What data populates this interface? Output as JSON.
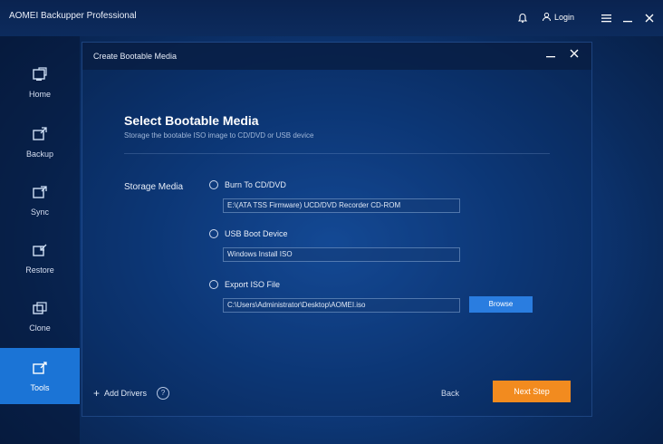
{
  "app": {
    "title": "AOMEI Backupper Professional",
    "login_label": "Login"
  },
  "sidebar": {
    "items": [
      {
        "label": "Home",
        "icon": "home-icon"
      },
      {
        "label": "Backup",
        "icon": "backup-icon"
      },
      {
        "label": "Sync",
        "icon": "sync-icon"
      },
      {
        "label": "Restore",
        "icon": "restore-icon"
      },
      {
        "label": "Clone",
        "icon": "clone-icon"
      },
      {
        "label": "Tools",
        "icon": "tools-icon",
        "active": true
      }
    ]
  },
  "dialog": {
    "title": "Create Bootable Media",
    "heading": "Select Bootable Media",
    "subheading": "Storage the bootable ISO image to CD/DVD or USB device",
    "storage_label": "Storage Media",
    "options": [
      {
        "label": "Burn To CD/DVD",
        "value": "E:\\(ATA TSS Firmware) UCD/DVD Recorder CD-ROM"
      },
      {
        "label": "USB Boot Device",
        "value": "Windows Install ISO"
      },
      {
        "label": "Export ISO File",
        "value": "C:\\Users\\Administrator\\Desktop\\AOMEI.iso"
      }
    ],
    "browse_label": "Browse",
    "add_device_label": "Add Drivers",
    "back_label": "Back",
    "next_label": "Next Step"
  },
  "colors": {
    "accent": "#1b74d6",
    "next_button": "#f28b1f"
  }
}
